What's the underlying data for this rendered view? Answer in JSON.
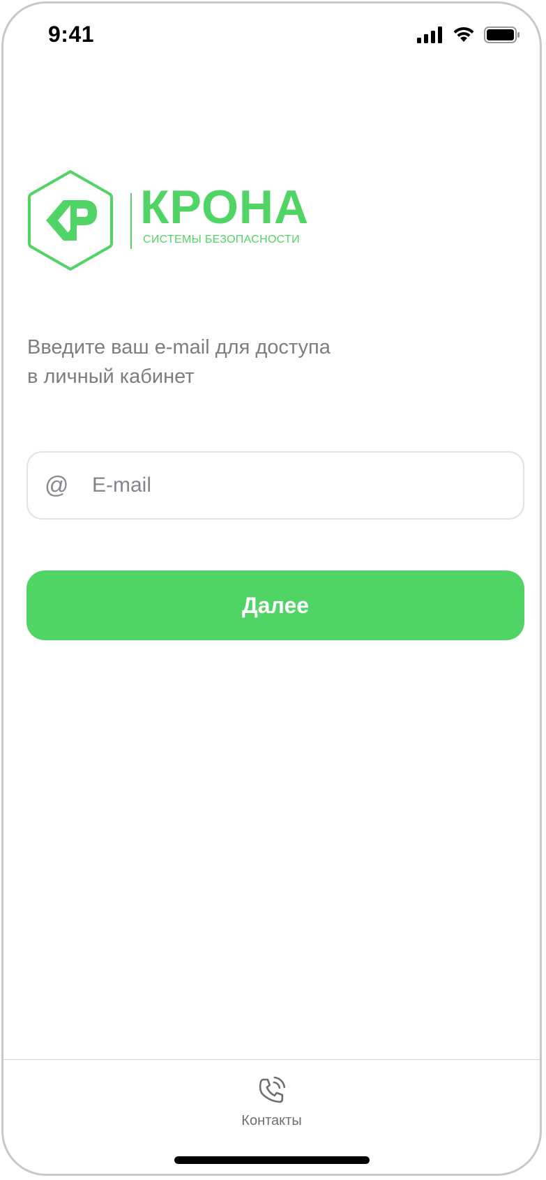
{
  "status_bar": {
    "time": "9:41",
    "icons": [
      "cellular-signal-icon",
      "wifi-icon",
      "battery-icon"
    ]
  },
  "logo": {
    "mark_letters": "KP",
    "word": "КРОНА",
    "tagline": "СИСТЕМЫ БЕЗОПАСНОСТИ"
  },
  "instruction": {
    "line1": "Введите ваш e-mail для доступа",
    "line2": "в личный кабинет"
  },
  "email_field": {
    "icon": "@",
    "value": "",
    "placeholder": "E-mail"
  },
  "next_button": {
    "label": "Далее"
  },
  "tab_bar": {
    "contacts_label": "Контакты",
    "contacts_icon": "phone-ringing-icon"
  },
  "colors": {
    "accent": "#51d466",
    "text_secondary": "#7d7d82",
    "border": "#e1e1e6"
  }
}
